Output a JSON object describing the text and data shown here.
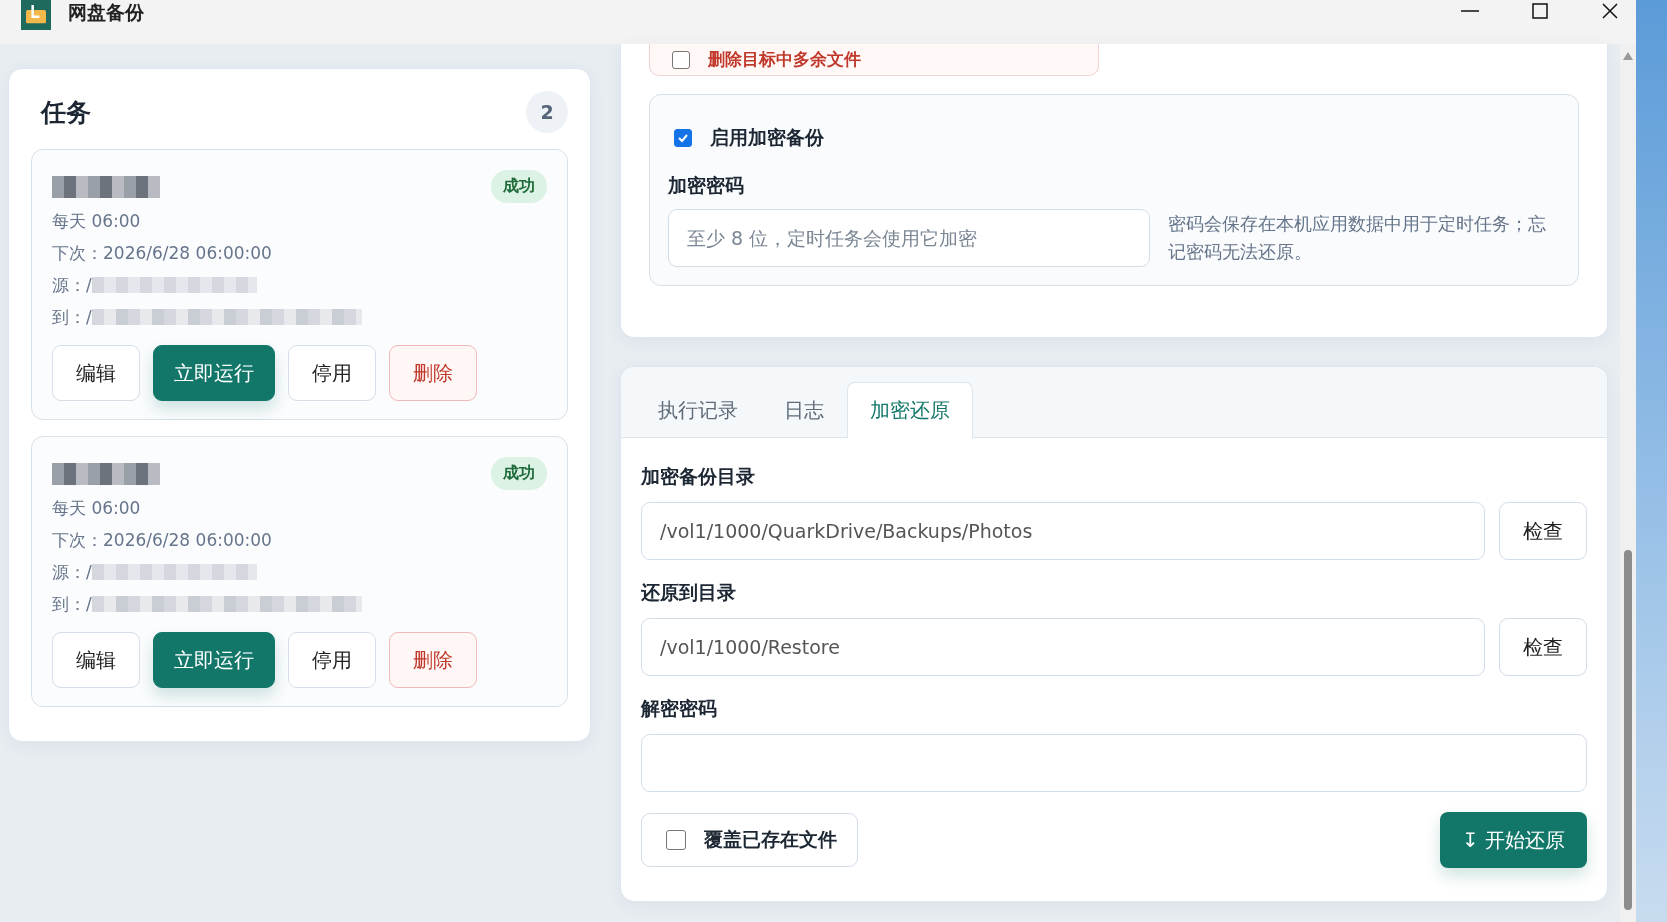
{
  "window": {
    "title": "网盘备份"
  },
  "tasks": {
    "title": "任务",
    "count": "2",
    "items": [
      {
        "status": "成功",
        "schedule": "每天 06:00",
        "next_run": "下次：2026/6/28 06:00:00",
        "source_label": "源：/",
        "dest_label": "到：/",
        "actions": [
          {
            "label": "编辑",
            "kind": "default"
          },
          {
            "label": "立即运行",
            "kind": "primary"
          },
          {
            "label": "停用",
            "kind": "default"
          },
          {
            "label": "删除",
            "kind": "danger"
          }
        ]
      },
      {
        "status": "成功",
        "schedule": "每天 06:00",
        "next_run": "下次：2026/6/28 06:00:00",
        "source_label": "源：/",
        "dest_label": "到：/",
        "actions": [
          {
            "label": "编辑",
            "kind": "default"
          },
          {
            "label": "立即运行",
            "kind": "primary"
          },
          {
            "label": "停用",
            "kind": "default"
          },
          {
            "label": "删除",
            "kind": "danger"
          }
        ]
      }
    ]
  },
  "options": {
    "delete_extra": {
      "label": "删除目标中多余文件",
      "checked": false
    },
    "encryption": {
      "label": "启用加密备份",
      "checked": true,
      "password_label": "加密密码",
      "password_placeholder": "至少 8 位，定时任务会使用它加密",
      "hint": "密码会保存在本机应用数据中用于定时任务；忘记密码无法还原。"
    }
  },
  "tabs": [
    {
      "label": "执行记录",
      "selected": false
    },
    {
      "label": "日志",
      "selected": false
    },
    {
      "label": "加密还原",
      "selected": true
    }
  ],
  "restore": {
    "fields": [
      {
        "label": "加密备份目录",
        "value": "/vol1/1000/QuarkDrive/Backups/Photos",
        "button": "检查"
      },
      {
        "label": "还原到目录",
        "value": "/vol1/1000/Restore",
        "button": "检查"
      },
      {
        "label": "解密密码"
      }
    ],
    "overwrite": {
      "label": "覆盖已存在文件",
      "checked": false
    },
    "start_button": {
      "icon": "↧",
      "label": "开始还原"
    }
  }
}
